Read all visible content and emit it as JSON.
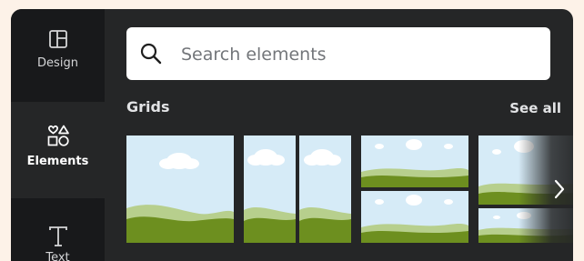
{
  "rail": {
    "items": [
      {
        "label": "Design",
        "icon": "layout-icon"
      },
      {
        "label": "Elements",
        "icon": "shapes-icon"
      },
      {
        "label": "Text",
        "icon": "text-icon"
      }
    ]
  },
  "search": {
    "placeholder": "Search elements",
    "value": ""
  },
  "section": {
    "title": "Grids",
    "see_all_label": "See all"
  },
  "grids": [
    {
      "layout": "single"
    },
    {
      "layout": "two-columns"
    },
    {
      "layout": "two-rows"
    },
    {
      "layout": "mixed"
    }
  ],
  "colors": {
    "page_background": "#fdf2e8",
    "panel_background": "#252627",
    "rail_background": "#18191b",
    "sky": "#d6ebf7",
    "grass_dark": "#6d8f1f",
    "grass_light": "#b7cf8d"
  }
}
